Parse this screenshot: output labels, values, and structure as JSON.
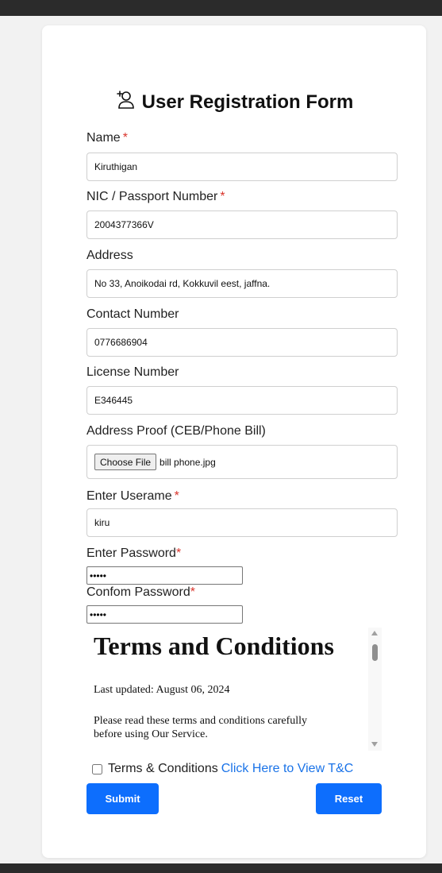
{
  "form": {
    "title": "User Registration Form",
    "title_icon": "user-add-icon",
    "required_mark": "*",
    "fields": {
      "name": {
        "label": "Name",
        "value": "Kiruthigan"
      },
      "nic": {
        "label": "NIC / Passport Number",
        "value": "2004377366V"
      },
      "address": {
        "label": "Address",
        "value": "No 33, Anoikodai rd, Kokkuvil eest, jaffna."
      },
      "contact": {
        "label": "Contact Number",
        "value": "0776686904"
      },
      "license": {
        "label": "License Number",
        "value": "E346445"
      },
      "address_proof": {
        "label": "Address Proof (CEB/Phone Bill)",
        "button_label": "Choose File",
        "file_name": "bill phone.jpg"
      },
      "username": {
        "label": "Enter Userame",
        "value": "kiru"
      },
      "password": {
        "label": "Enter Password",
        "value": "•••••"
      },
      "confirm_password": {
        "label": "Confom Password",
        "value": "•••••"
      }
    },
    "terms": {
      "heading": "Terms and Conditions",
      "last_updated": "Last updated: August 06, 2024",
      "paragraph": "Please read these terms and conditions carefully before using Our Service."
    },
    "terms_checkbox": {
      "label": "Terms & Conditions",
      "link_text": "Click Here to View T&C",
      "checked": false
    },
    "buttons": {
      "submit": "Submit",
      "reset": "Reset"
    }
  },
  "colors": {
    "accent": "#0d6efd",
    "link": "#1a73e8",
    "required": "#d9342b",
    "frame": "#2b2b2b"
  }
}
